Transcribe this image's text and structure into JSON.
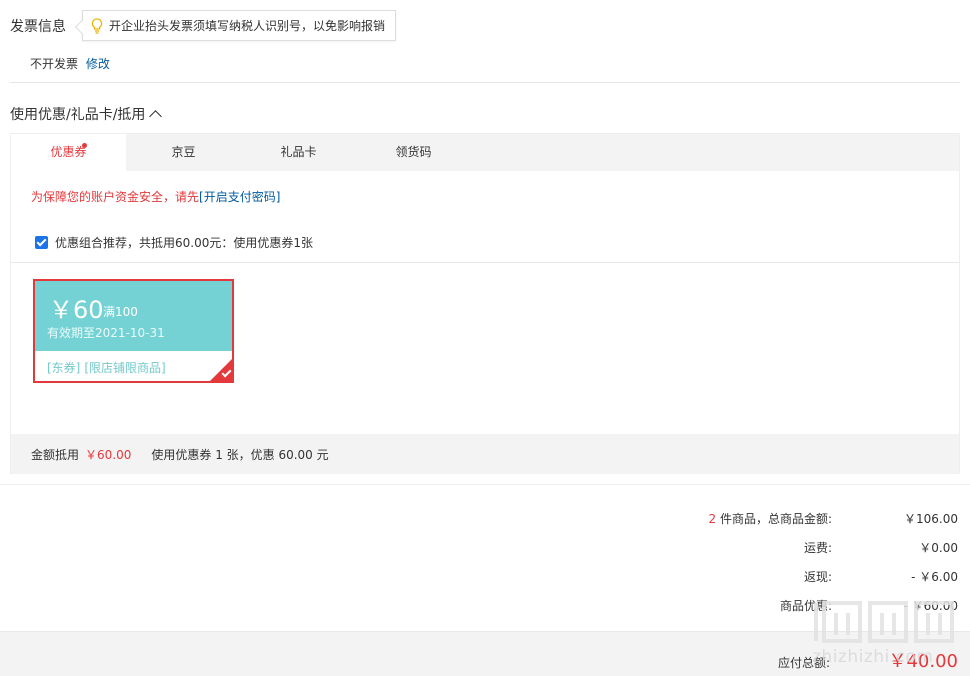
{
  "invoice": {
    "title": "发票信息",
    "tip": "开企业抬头发票须填写纳税人识别号，以免影响报销",
    "status": "不开发票",
    "edit_link": "修改"
  },
  "coupon_section": {
    "title": "使用优惠/礼品卡/抵用",
    "tabs": [
      {
        "label": "优惠券",
        "active": true,
        "badge_dot": true
      },
      {
        "label": "京豆",
        "active": false
      },
      {
        "label": "礼品卡",
        "active": false
      },
      {
        "label": "领货码",
        "active": false
      }
    ],
    "warning_text": "为保障您的账户资金安全，请先",
    "warning_link": "[开启支付密码]",
    "combo_checked": true,
    "combo_text": "优惠组合推荐，共抵用60.00元：使用优惠券1张",
    "coupon": {
      "currency": "￥",
      "amount": "60",
      "condition": "满100",
      "expiry": "有效期至2021-10-31",
      "tag1": "[东券]",
      "tag2": "[限店铺限商品]",
      "selected": true
    },
    "summary_label": "金额抵用",
    "summary_amount": "￥60.00",
    "summary_desc": "使用优惠券 1 张，优惠 60.00 元"
  },
  "totals": {
    "items_count": "2",
    "items_label": " 件商品，总商品金额:",
    "items_value": "￥106.00",
    "shipping_label": "运费:",
    "shipping_value": "￥0.00",
    "cashback_label": "返现:",
    "cashback_value": "- ￥6.00",
    "discount_label": "商品优惠:",
    "discount_value": "- ￥60.00",
    "payable_label": "应付总额:",
    "payable_value": "￥40.00"
  },
  "watermark": {
    "logo_chars": "值",
    "text": "zhizhizhi.com"
  },
  "colors": {
    "accent_red": "#e4393c",
    "link_blue": "#005aa0",
    "coupon_teal": "#74d2d4"
  }
}
